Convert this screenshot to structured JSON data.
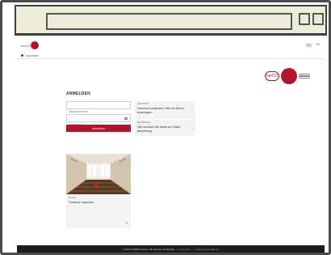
{
  "header": {
    "logo_text": "heiCO"
  },
  "language": {
    "items": [
      "DE",
      "EN"
    ]
  },
  "breadcrumb": {
    "label": "Anmelden"
  },
  "login": {
    "title": "ANMELDEN",
    "username_placeholder": "Benutzername",
    "password_placeholder": "Kennwort",
    "button_label": "Anmelden"
  },
  "info_boxes": [
    {
      "kicker": "KENNWORT",
      "text": "Kennwort vergessen? Hier ein Neues beantragen"
    },
    {
      "kicker": "BEWERBUNG",
      "text": "Hier kommen Sie direkt zur Online-Bewerbung"
    }
  ],
  "card": {
    "kicker": "SUCHE",
    "title": "Campus Lageplan"
  },
  "footer": {
    "copyright": "© 2023 CAMPUSonline. Alle Rechte vorbehalten.",
    "separator": "|",
    "imprint": "Impressum",
    "privacy": "Datenschutzerklärung"
  },
  "colors": {
    "accent": "#b3142c",
    "footer_bg": "#1d1d1d",
    "chrome": "#ececd9"
  }
}
